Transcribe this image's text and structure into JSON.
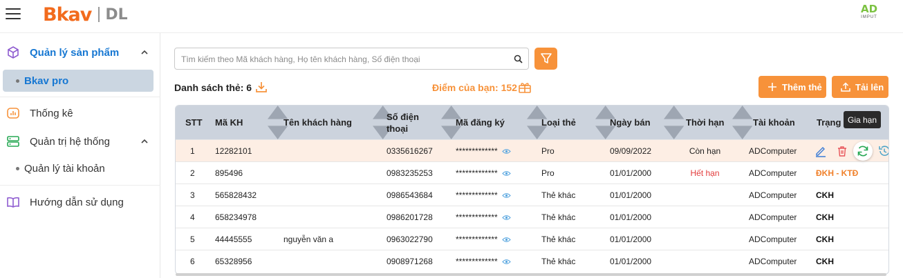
{
  "header": {
    "brand": "Bkav",
    "brand_suffix": "DL",
    "partner_logo_main": "AD",
    "partner_logo_sub": "IMPUT"
  },
  "sidebar": {
    "items": [
      {
        "label": "Quản lý sản phẩm",
        "icon": "cube-icon",
        "expanded": true,
        "active": true
      },
      {
        "label": "Bkav pro",
        "sub": true,
        "active": true
      },
      {
        "label": "Thống kê",
        "icon": "chart-icon"
      },
      {
        "label": "Quản trị hệ thống",
        "icon": "server-icon",
        "expanded": true
      },
      {
        "label": "Quản lý tài khoản",
        "sub": true
      },
      {
        "label": "Hướng dẫn sử dụng",
        "icon": "book-icon"
      }
    ]
  },
  "toolbar": {
    "search_placeholder": "Tìm kiếm theo Mã khách hàng, Họ tên khách hàng, Số điện thoại",
    "list_title": "Danh sách thẻ: 6",
    "points_label": "Điểm của bạn: 152",
    "add_label": "Thêm thẻ",
    "upload_label": "Tải lên"
  },
  "colors": {
    "accent": "#f7923a",
    "active_blue": "#1677d2",
    "header_row": "#ccd3dd",
    "highlight_row": "#fdeee4",
    "expired_red": "#e23b3b"
  },
  "table": {
    "columns": [
      "STT",
      "Mã KH",
      "Tên khách hàng",
      "Số điện thoại",
      "Mã đăng ký",
      "Loại thẻ",
      "Ngày bán",
      "Thời hạn",
      "Tài khoản",
      "Trạng thái"
    ],
    "masked_code": "*************",
    "rows": [
      {
        "stt": "1",
        "ma_kh": "12282101",
        "ten": "",
        "sdt": "0335616267",
        "loai": "Pro",
        "ngay": "09/09/2022",
        "thoi_han": "Còn hạn",
        "tai_khoan": "ADComputer",
        "trang_thai": ""
      },
      {
        "stt": "2",
        "ma_kh": "895496",
        "ten": "",
        "sdt": "0983235253",
        "loai": "Pro",
        "ngay": "01/01/2000",
        "thoi_han": "Hết hạn",
        "tai_khoan": "ADComputer",
        "trang_thai": "ĐKH - KTĐ"
      },
      {
        "stt": "3",
        "ma_kh": "565828432",
        "ten": "",
        "sdt": "0986543684",
        "loai": "Thẻ khác",
        "ngay": "01/01/2000",
        "thoi_han": "",
        "tai_khoan": "ADComputer",
        "trang_thai": "CKH"
      },
      {
        "stt": "4",
        "ma_kh": "658234978",
        "ten": "",
        "sdt": "0986201728",
        "loai": "Thẻ khác",
        "ngay": "01/01/2000",
        "thoi_han": "",
        "tai_khoan": "ADComputer",
        "trang_thai": "CKH"
      },
      {
        "stt": "5",
        "ma_kh": "44445555",
        "ten": "nguyễn văn a",
        "sdt": "0963022790",
        "loai": "Thẻ khác",
        "ngay": "01/01/2000",
        "thoi_han": "",
        "tai_khoan": "ADComputer",
        "trang_thai": "CKH"
      },
      {
        "stt": "6",
        "ma_kh": "65328956",
        "ten": "",
        "sdt": "0908971268",
        "loai": "Thẻ khác",
        "ngay": "01/01/2000",
        "thoi_han": "",
        "tai_khoan": "ADComputer",
        "trang_thai": "CKH"
      }
    ]
  },
  "tooltip": {
    "label": "Gia hạn"
  }
}
